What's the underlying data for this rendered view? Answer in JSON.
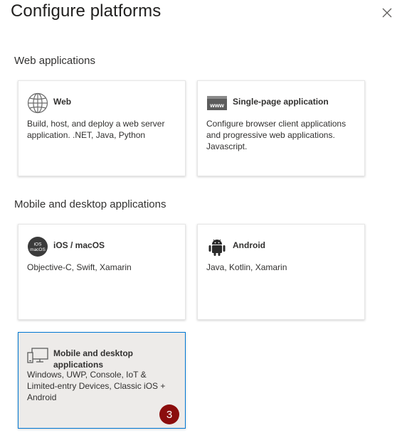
{
  "panel": {
    "title": "Configure platforms",
    "close_icon": "close-icon"
  },
  "sections": {
    "web": {
      "heading": "Web applications",
      "cards": {
        "web": {
          "icon": "globe-icon",
          "title": "Web",
          "description": "Build, host, and deploy a web server application. .NET, Java, Python"
        },
        "spa": {
          "icon": "www-browser-icon",
          "icon_text": "www",
          "title": "Single-page application",
          "description": "Configure browser client applications and progressive web applications. Javascript."
        }
      }
    },
    "mobile": {
      "heading": "Mobile and desktop applications",
      "cards": {
        "ios": {
          "icon": "ios-macos-icon",
          "icon_text_top": "iOS",
          "icon_text_bottom": "macOS",
          "title": "iOS / macOS",
          "description": "Objective-C, Swift, Xamarin"
        },
        "android": {
          "icon": "android-icon",
          "title": "Android",
          "description": "Java, Kotlin, Xamarin"
        },
        "desktop": {
          "icon": "desktop-device-icon",
          "title": "Mobile and desktop applications",
          "description": "Windows, UWP, Console, IoT & Limited-entry Devices, Classic iOS + Android",
          "selected": true,
          "badge": "3"
        }
      }
    }
  },
  "colors": {
    "selected_border": "#0078d4",
    "selected_background": "#edebe9",
    "badge_background": "#8b0d0d"
  }
}
